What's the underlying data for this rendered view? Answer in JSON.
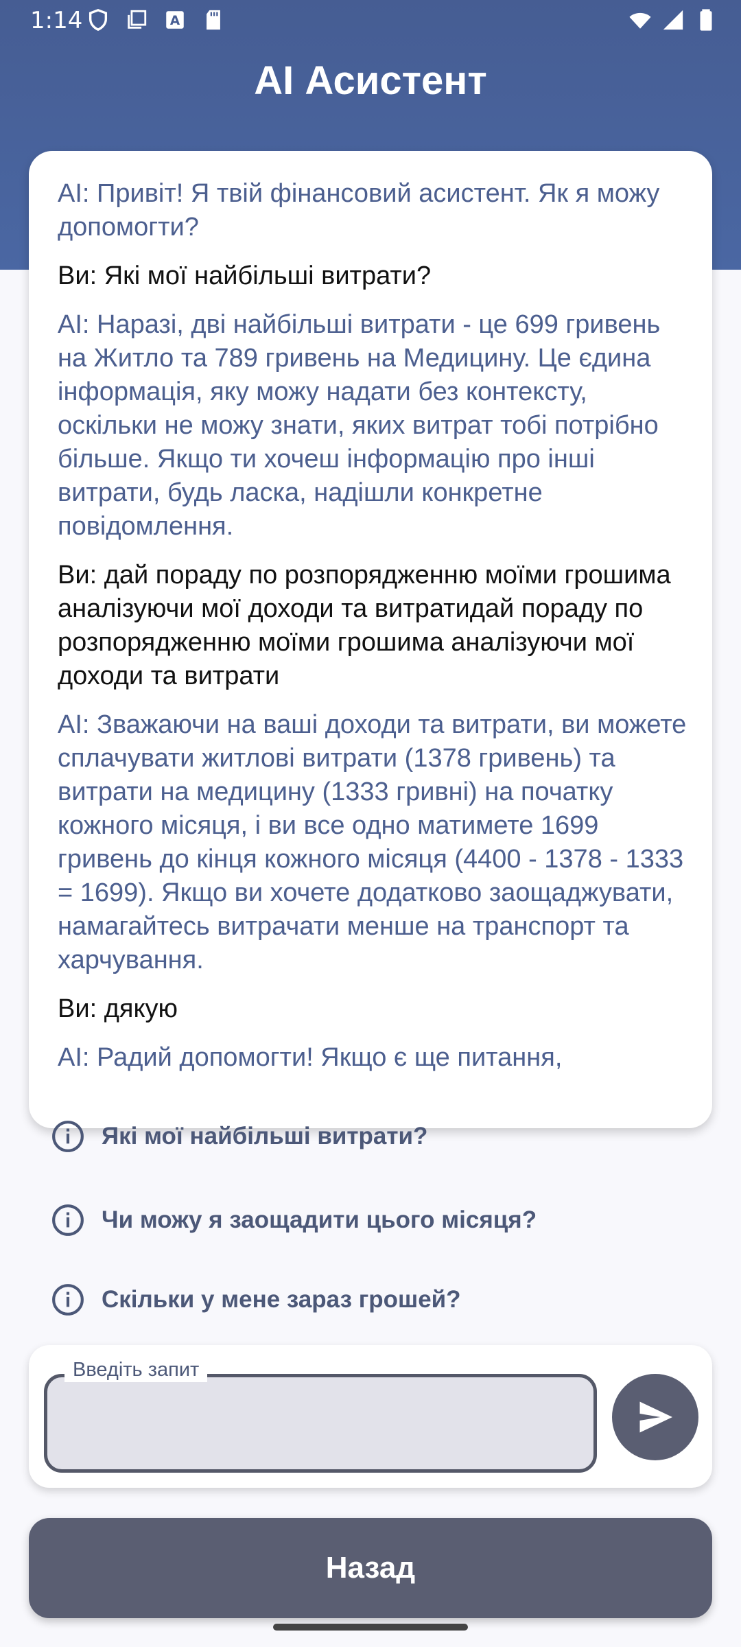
{
  "status_bar": {
    "time": "1:14",
    "icons_left": [
      "shield-icon",
      "screen-copy-icon",
      "keyboard-a-icon",
      "sd-card-icon"
    ],
    "icons_right": [
      "wifi-icon",
      "signal-icon",
      "battery-icon"
    ]
  },
  "header": {
    "title": "AI Асистент"
  },
  "chat": {
    "messages": [
      {
        "role": "ai",
        "text": "AI: Привіт! Я твій фінансовий асистент. Як я можу допомогти?"
      },
      {
        "role": "user",
        "text": "Ви: Які мої найбільші витрати?"
      },
      {
        "role": "ai",
        "text": "AI: Наразі, дві найбільші витрати - це 699 гривень на Житло та 789 гривень на Медицину. Це єдина інформація, яку можу надати без контексту, оскільки не можу знати, яких витрат тобі потрібно більше. Якщо ти хочеш інформацію про інші витрати, будь ласка, надішли конкретне повідомлення."
      },
      {
        "role": "user",
        "text": "Ви: дай пораду по розпорядженню моїми грошима аналізуючи мої доходи та витратидай пораду по розпорядженню моїми грошима аналізуючи мої доходи та витрати"
      },
      {
        "role": "ai",
        "text": "AI: Зважаючи на ваші доходи та витрати, ви можете сплачувати житлові витрати (1378 гривень) та витрати на медицину (1333 гривні) на початку кожного місяця, і ви все одно матимете 1699 гривень до кінця кожного місяця (4400 - 1378 - 1333 = 1699). Якщо ви хочете додатково заощаджувати, намагайтесь витрачати менше на транспорт та харчування."
      },
      {
        "role": "user",
        "text": "Ви: дякую"
      },
      {
        "role": "ai",
        "text": "AI: Радий допомогти! Якщо є ще питання,"
      }
    ]
  },
  "suggestions": [
    {
      "text": "Які мої найбільші витрати?",
      "icon": "info-icon"
    },
    {
      "text": "Чи можу я заощадити цього місяця?",
      "icon": "info-icon"
    },
    {
      "text": "Скільки у мене зараз грошей?",
      "icon": "info-icon"
    }
  ],
  "input": {
    "label": "Введіть запит",
    "value": "",
    "send_icon": "send-icon"
  },
  "back_button": {
    "label": "Назад"
  },
  "colors": {
    "header": "#465d93",
    "ai_text": "#4c5f8f",
    "user_text": "#111111",
    "button": "#5a5e72",
    "suggestion_text": "#4c5878"
  }
}
